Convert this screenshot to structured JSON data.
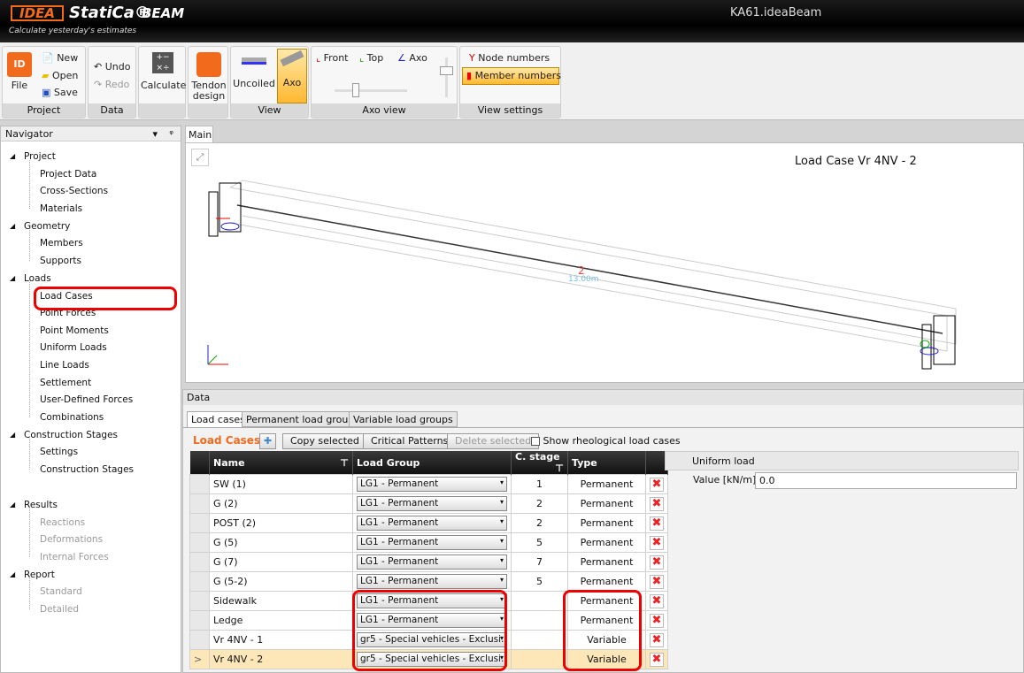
{
  "app": {
    "logo": "IDEA StatiCa",
    "product": "BEAM",
    "tagline": "Calculate yesterday's estimates",
    "document": "KA61.ideaBeam"
  },
  "ribbon": {
    "groups": [
      "Project",
      "Data",
      "",
      "",
      "View",
      "Axo view",
      "View settings"
    ],
    "file": "File",
    "new": "New",
    "open": "Open",
    "save": "Save",
    "undo": "Undo",
    "redo": "Redo",
    "calculate": "Calculate",
    "tendon": "Tendon",
    "tendon2": "design",
    "uncoiled": "Uncoiled",
    "axo": "Axo",
    "front": "Front",
    "top": "Top",
    "axo_view": "Axo",
    "node_numbers": "Node numbers",
    "member_numbers": "Member numbers"
  },
  "navigator": {
    "title": "Navigator",
    "pin": "ᵖ",
    "sections": [
      {
        "label": "Project",
        "items": [
          "Project Data",
          "Cross-Sections",
          "Materials"
        ]
      },
      {
        "label": "Geometry",
        "items": [
          "Members",
          "Supports"
        ]
      },
      {
        "label": "Loads",
        "items": [
          "Load Cases",
          "Point Forces",
          "Point Moments",
          "Uniform Loads",
          "Line Loads",
          "Settlement",
          "User-Defined Forces",
          "Combinations"
        ]
      },
      {
        "label": "Construction Stages",
        "items": [
          "Settings",
          "Construction Stages"
        ]
      },
      {
        "label": "Results",
        "items": [
          "Reactions",
          "Deformations",
          "Internal Forces"
        ]
      },
      {
        "label": "Report",
        "items": [
          "Standard",
          "Detailed"
        ]
      }
    ]
  },
  "main": {
    "tab": "Main",
    "view_title": "Load Case Vr 4NV - 2",
    "member_label": "2",
    "length_label": "13.00m"
  },
  "data": {
    "title": "Data",
    "tabs": [
      "Load cases",
      "Permanent load groups",
      "Variable load groups"
    ],
    "section_title": "Load Cases",
    "copy": "Copy selected",
    "critical": "Critical Patterns",
    "delete": "Delete selected",
    "show_rheo": "Show rheological load cases",
    "columns": [
      "Name",
      "Load Group",
      "C. stage",
      "Type"
    ],
    "rows": [
      {
        "name": "SW (1)",
        "group": "LG1 - Permanent",
        "stage": "1",
        "type": "Permanent"
      },
      {
        "name": "G (2)",
        "group": "LG1 - Permanent",
        "stage": "2",
        "type": "Permanent"
      },
      {
        "name": "POST (2)",
        "group": "LG1 - Permanent",
        "stage": "2",
        "type": "Permanent"
      },
      {
        "name": "G (5)",
        "group": "LG1 - Permanent",
        "stage": "5",
        "type": "Permanent"
      },
      {
        "name": "G (7)",
        "group": "LG1 - Permanent",
        "stage": "7",
        "type": "Permanent"
      },
      {
        "name": "G (5-2)",
        "group": "LG1 - Permanent",
        "stage": "5",
        "type": "Permanent"
      },
      {
        "name": "Sidewalk",
        "group": "LG1 - Permanent",
        "stage": "",
        "type": "Permanent"
      },
      {
        "name": "Ledge",
        "group": "LG1 - Permanent",
        "stage": "",
        "type": "Permanent"
      },
      {
        "name": "Vr 4NV - 1",
        "group": "gr5 - Special vehicles - Exclusi...",
        "stage": "",
        "type": "Variable"
      },
      {
        "name": "Vr 4NV - 2",
        "group": "gr5 - Special vehicles - Exclusi...",
        "stage": "",
        "type": "Variable",
        "selected": true,
        "marker": ">"
      }
    ],
    "properties": {
      "header": "Uniform load",
      "label": "Value [kN/m]",
      "value": "0.0"
    }
  },
  "colors": {
    "accent": "#f26a1b",
    "highlight": "#fde6b8",
    "annotation": "#e00000"
  }
}
